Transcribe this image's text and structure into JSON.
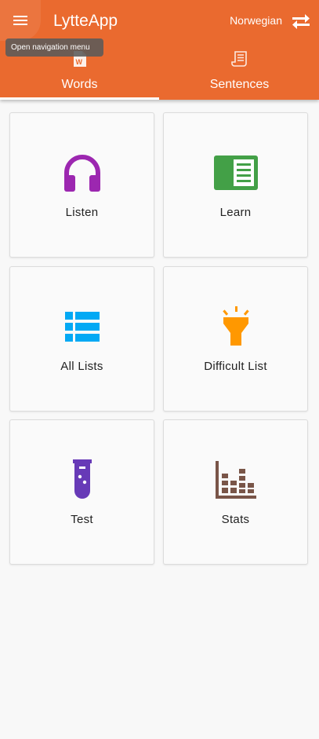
{
  "app": {
    "title": "LytteApp",
    "language": "Norwegian",
    "accent_color": "#ea6a2f",
    "menu_tooltip": "Open navigation menu"
  },
  "tabs": [
    {
      "label": "Words",
      "icon": "word-document-icon",
      "selected": true
    },
    {
      "label": "Sentences",
      "icon": "script-icon",
      "selected": false
    }
  ],
  "cards": [
    {
      "label": "Listen",
      "icon": "headphones-icon",
      "color": "#9c27b0"
    },
    {
      "label": "Learn",
      "icon": "book-icon",
      "color": "#43a047"
    },
    {
      "label": "All Lists",
      "icon": "list-icon",
      "color": "#03a9f4"
    },
    {
      "label": "Difficult List",
      "icon": "flashlight-icon",
      "color": "#ff9800"
    },
    {
      "label": "Test",
      "icon": "test-tube-icon",
      "color": "#673ab7"
    },
    {
      "label": "Stats",
      "icon": "bar-chart-icon",
      "color": "#795548"
    }
  ]
}
